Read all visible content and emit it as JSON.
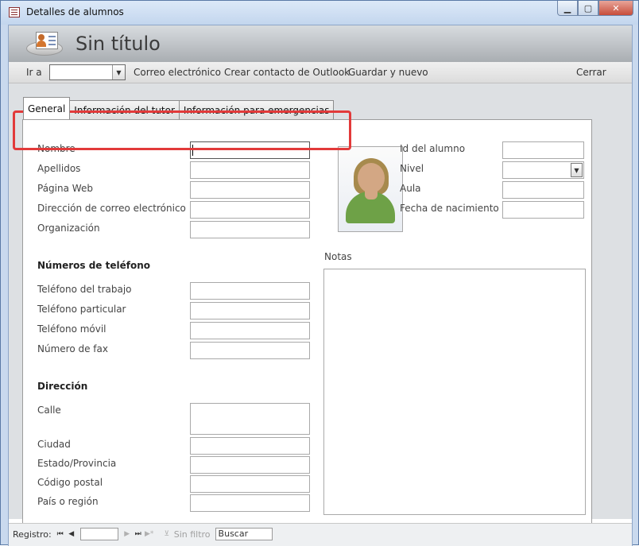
{
  "window": {
    "title": "Detalles de alumnos",
    "min_label": "▁",
    "max_label": "▢",
    "close_label": "✕"
  },
  "header": {
    "form_title": "Sin título"
  },
  "toolbar": {
    "goto_label": "Ir a",
    "goto_value": "",
    "email_label": "Correo electrónico",
    "outlook_label": "Crear contacto de Outlook",
    "save_new_label": "Guardar y nuevo",
    "close_label": "Cerrar"
  },
  "tabs": [
    {
      "label": "General",
      "active": true
    },
    {
      "label": "Información del tutor",
      "active": false
    },
    {
      "label": "Información para emergencias",
      "active": false
    }
  ],
  "form": {
    "fields_left": [
      {
        "label": "Nombre",
        "value": ""
      },
      {
        "label": "Apellidos",
        "value": ""
      },
      {
        "label": "Página Web",
        "value": ""
      },
      {
        "label": "Dirección de correo electrónico",
        "value": ""
      },
      {
        "label": "Organización",
        "value": ""
      }
    ],
    "phones_heading": "Números de teléfono",
    "phones": [
      {
        "label": "Teléfono del trabajo",
        "value": ""
      },
      {
        "label": "Teléfono particular",
        "value": ""
      },
      {
        "label": "Teléfono móvil",
        "value": ""
      },
      {
        "label": "Número de fax",
        "value": ""
      }
    ],
    "address_heading": "Dirección",
    "address": [
      {
        "label": "Calle",
        "value": ""
      },
      {
        "label": "Ciudad",
        "value": ""
      },
      {
        "label": "Estado/Provincia",
        "value": ""
      },
      {
        "label": "Código postal",
        "value": ""
      },
      {
        "label": "País o región",
        "value": ""
      }
    ],
    "fields_right": [
      {
        "label": "Id del alumno",
        "value": ""
      },
      {
        "label": "Nivel",
        "value": ""
      },
      {
        "label": "Aula",
        "value": ""
      },
      {
        "label": "Fecha de nacimiento",
        "value": ""
      }
    ],
    "notes_label": "Notas",
    "notes_value": ""
  },
  "navbar": {
    "record_label": "Registro:",
    "record_value": "",
    "filter_label": "Sin filtro",
    "search_placeholder": "Buscar"
  },
  "colors": {
    "highlight": "#e23a3a",
    "window_frame": "#c9d9ee"
  }
}
